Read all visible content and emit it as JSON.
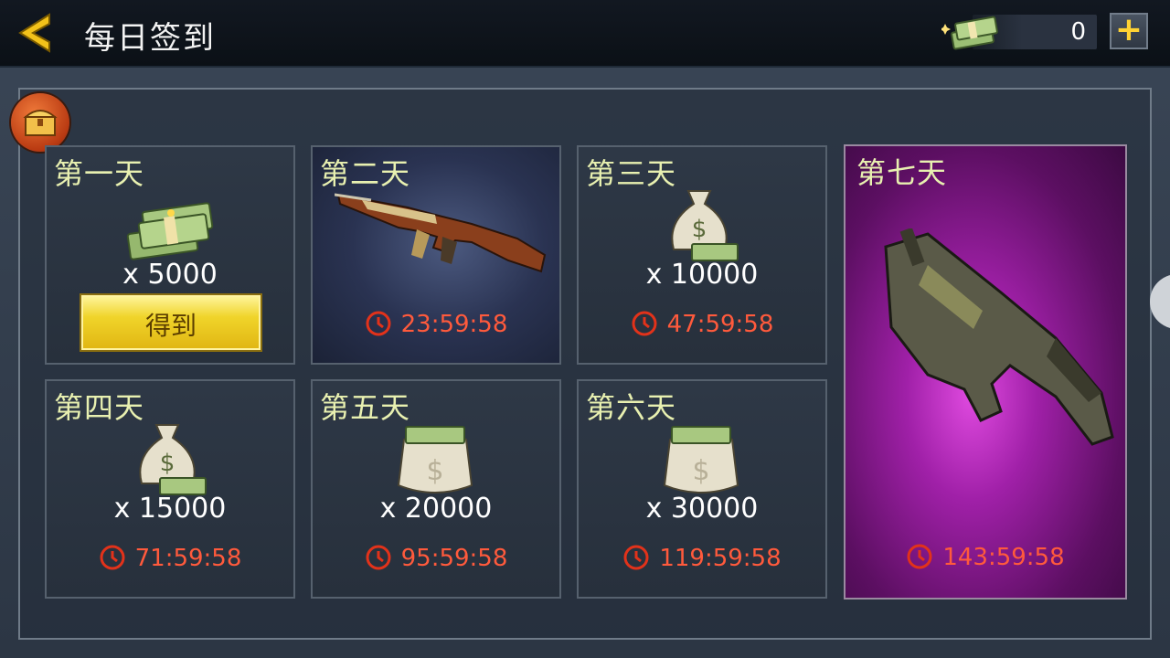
{
  "header": {
    "title": "每日签到",
    "currency_value": "0",
    "plus_label": "+"
  },
  "claim_label": "得到",
  "days": [
    {
      "label": "第一天",
      "reward": "cash",
      "qty": "x 5000",
      "claimable": true
    },
    {
      "label": "第二天",
      "reward": "ak47-rifle",
      "timer": "23:59:58"
    },
    {
      "label": "第三天",
      "reward": "money-bag-small",
      "qty": "x 10000",
      "timer": "47:59:58"
    },
    {
      "label": "第四天",
      "reward": "money-bag-small",
      "qty": "x 15000",
      "timer": "71:59:58"
    },
    {
      "label": "第五天",
      "reward": "money-bag-large",
      "qty": "x 20000",
      "timer": "95:59:58"
    },
    {
      "label": "第六天",
      "reward": "money-bag-large",
      "qty": "x 30000",
      "timer": "119:59:58"
    },
    {
      "label": "第七天",
      "reward": "ump-smg",
      "timer": "143:59:58"
    }
  ],
  "colors": {
    "accent_yellow": "#f0d42a",
    "timer_red": "#ff5a3c",
    "day_label": "#e8f0b0",
    "purple_glow": "#a020a8"
  }
}
